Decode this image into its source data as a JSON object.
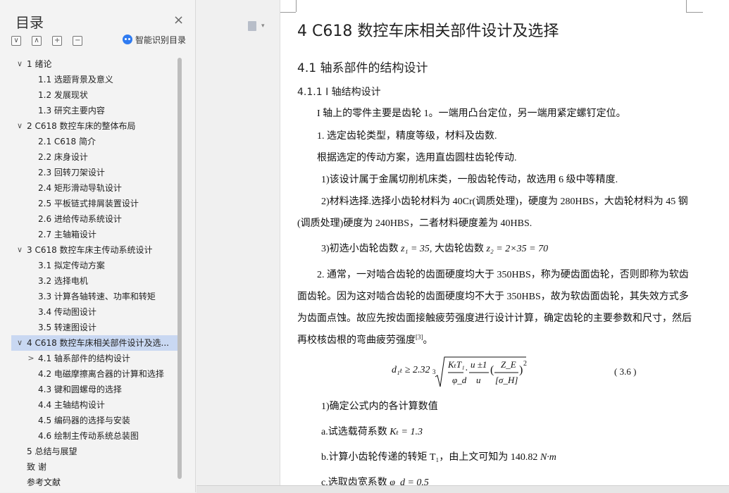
{
  "sidebar": {
    "title": "目录",
    "close_icon": "×",
    "tools": [
      "∨",
      "∧",
      "+",
      "−"
    ],
    "smart_toc_label": "智能识别目录",
    "items": [
      {
        "arrow": "∨",
        "label": "1 绪论",
        "level": 0
      },
      {
        "arrow": "",
        "label": "1.1 选题背景及意义",
        "level": 1
      },
      {
        "arrow": "",
        "label": "1.2 发展现状",
        "level": 1
      },
      {
        "arrow": "",
        "label": "1.3 研究主要内容",
        "level": 1
      },
      {
        "arrow": "∨",
        "label": "2 C618 数控车床的整体布局",
        "level": 0
      },
      {
        "arrow": "",
        "label": "2.1 C618 简介",
        "level": 1
      },
      {
        "arrow": "",
        "label": "2.2  床身设计",
        "level": 1
      },
      {
        "arrow": "",
        "label": "2.3  回转刀架设计",
        "level": 1
      },
      {
        "arrow": "",
        "label": "2.4  矩形滑动导轨设计",
        "level": 1
      },
      {
        "arrow": "",
        "label": "2.5 平板链式排屑装置设计",
        "level": 1
      },
      {
        "arrow": "",
        "label": "2.6 进给传动系统设计",
        "level": 1
      },
      {
        "arrow": "",
        "label": "2.7 主轴箱设计",
        "level": 1
      },
      {
        "arrow": "∨",
        "label": "3 C618 数控车床主传动系统设计",
        "level": 0
      },
      {
        "arrow": "",
        "label": "3.1  拟定传动方案",
        "level": 1
      },
      {
        "arrow": "",
        "label": "3.2  选择电机",
        "level": 1
      },
      {
        "arrow": "",
        "label": "3.3  计算各轴转速、功率和转矩",
        "level": 1
      },
      {
        "arrow": "",
        "label": "3.4  传动图设计",
        "level": 1
      },
      {
        "arrow": "",
        "label": "3.5  转速图设计",
        "level": 1
      },
      {
        "arrow": "∨",
        "label": "4 C618 数控车床相关部件设计及选...",
        "level": 0,
        "selected": true
      },
      {
        "arrow": ">",
        "label": "4.1 轴系部件的结构设计",
        "level": 1
      },
      {
        "arrow": "",
        "label": "4.2 电磁摩擦离合器的计算和选择",
        "level": 1
      },
      {
        "arrow": "",
        "label": "4.3 键和圆螺母的选择",
        "level": 1
      },
      {
        "arrow": "",
        "label": "4.4 主轴结构设计",
        "level": 1
      },
      {
        "arrow": "",
        "label": "4.5 编码器的选择与安装",
        "level": 1
      },
      {
        "arrow": "",
        "label": "4.6 绘制主传动系统总装图",
        "level": 1
      },
      {
        "arrow": "",
        "label": "5 总结与展望",
        "level": 0
      },
      {
        "arrow": "",
        "label": "致   谢",
        "level": 0
      },
      {
        "arrow": "",
        "label": "参考文献",
        "level": 0
      }
    ]
  },
  "document": {
    "h1": "4 C618 数控车床相关部件设计及选择",
    "h2": "4.1 轴系部件的结构设计",
    "h3": "4.1.1 I 轴结构设计",
    "p1": "I 轴上的零件主要是齿轮 1。一端用凸台定位，另一端用紧定螺钉定位。",
    "p2": "1. 选定齿轮类型，精度等级，材料及齿数.",
    "p3": "根据选定的传动方案，选用直齿圆柱齿轮传动.",
    "p4": "1)该设计属于金属切削机床类，一般齿轮传动，故选用 6 级中等精度.",
    "p5a": "2)材料选择.选择小齿轮材料为 40Cr(调质处理)，硬度为 280HBS，大齿轮材料为 45 钢",
    "p5b": "(调质处理)硬度为 240HBS，二者材料硬度差为 40HBS.",
    "p6_prefix": "3)初选小齿轮齿数",
    "p6_z1": "z₁ = 35,",
    "p6_mid": "大齿轮齿数",
    "p6_z2": "z₂ = 2×35 = 70",
    "p7a": "2. 通常，一对啮合齿轮的齿面硬度均大于 350HBS，称为硬齿面齿轮，否则即称为软齿",
    "p7b": "面齿轮。因为这对啮合齿轮的齿面硬度均不大于 350HBS，故为软齿面齿轮，其失效方式多",
    "p7c": "为齿面点蚀。故应先按齿面接触疲劳强度进行设计计算，确定齿轮的主要参数和尺寸，然后",
    "p7d": "再校核齿根的弯曲疲劳强度",
    "p7d_ref": "[3]",
    "p7d_end": "。",
    "formula_lhs": "d₁ₜ ≥ 2.32",
    "formula_root_index": "3",
    "formula_frac1_num": "KₜT₁",
    "formula_frac1_den": "φ_d",
    "formula_frac2_num": "u ±1",
    "formula_frac2_den": "u",
    "formula_frac3_num": "Z_E",
    "formula_frac3_den": "[σ_H]",
    "formula_exp": "2",
    "formula_no": "( 3.6 )",
    "p8": "1)确定公式内的各计算数值",
    "p9_prefix": "a.试选载荷系数",
    "p9_math": "Kₜ = 1.3",
    "p10_prefix": "b.计算小齿轮传递的转矩 T₁，由上文可知为 140.82",
    "p10_unit": "N·m",
    "p11_prefix": "c.选取齿宽系数",
    "p11_math": "φ_d = 0.5"
  }
}
